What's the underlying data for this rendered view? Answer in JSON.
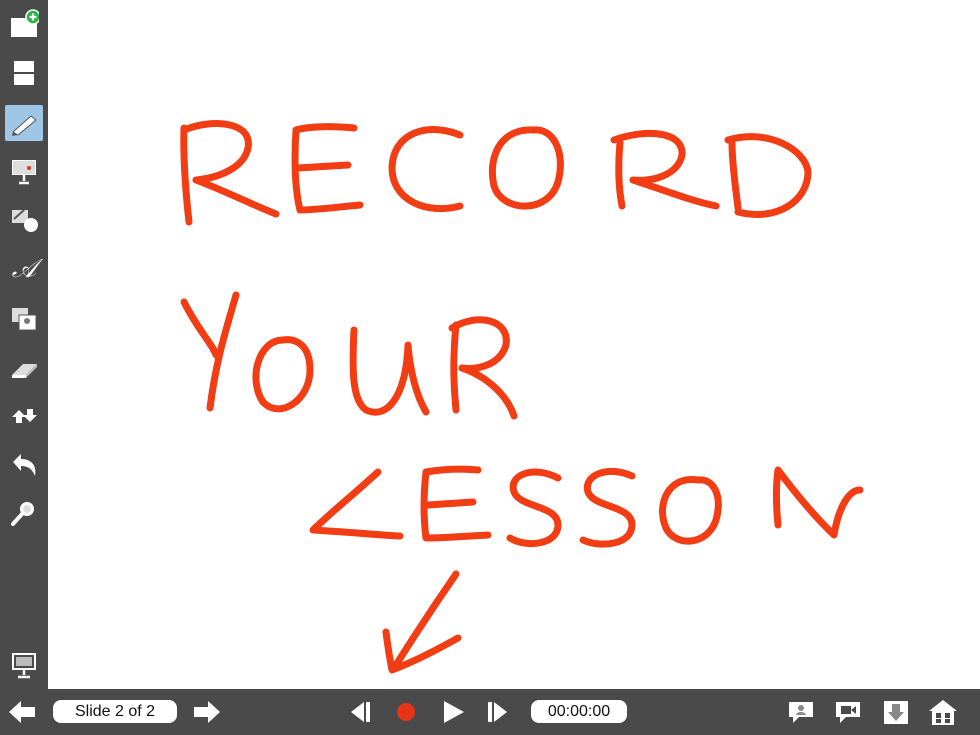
{
  "toolbar": {
    "tools": [
      {
        "name": "new-slide-icon"
      },
      {
        "name": "layout-icon"
      },
      {
        "name": "pen-icon",
        "active": true
      },
      {
        "name": "laser-pointer-icon"
      },
      {
        "name": "shapes-icon"
      },
      {
        "name": "text-icon",
        "glyph": "𝒜"
      },
      {
        "name": "image-icon"
      },
      {
        "name": "eraser-icon"
      },
      {
        "name": "move-icon"
      },
      {
        "name": "undo-icon"
      },
      {
        "name": "zoom-icon"
      }
    ],
    "present_icon": "presentation-icon"
  },
  "canvas": {
    "handwriting_lines": [
      "RECORD",
      "YOUR",
      "LESSON"
    ],
    "ink_color": "#f23c14"
  },
  "bottom_bar": {
    "slide_indicator": "Slide 2 of 2",
    "timer": "00:00:00",
    "record_color": "#e53418"
  }
}
